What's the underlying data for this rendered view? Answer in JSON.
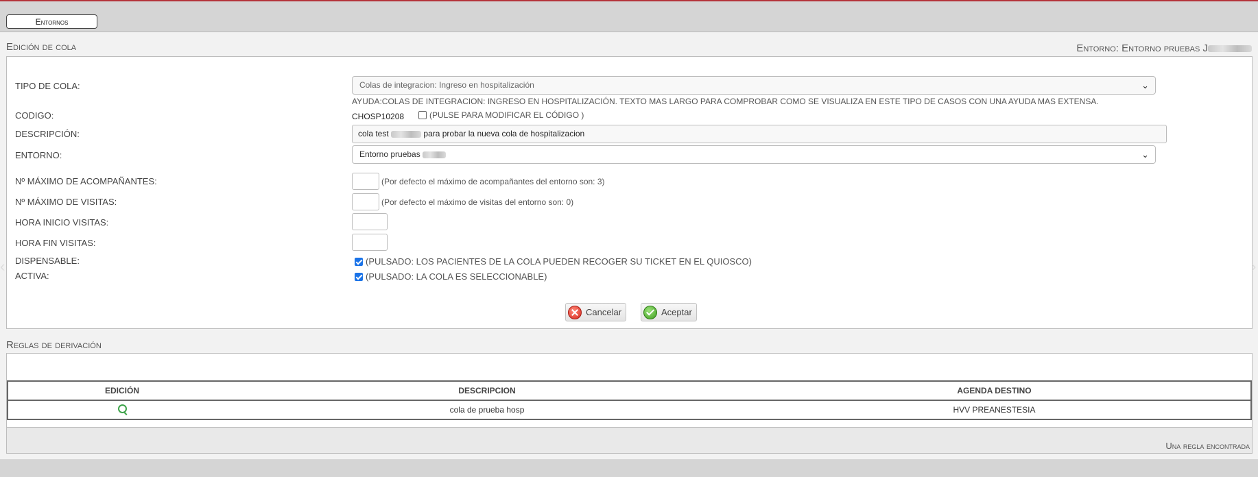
{
  "nav": {
    "entornos_label": "Entornos"
  },
  "edit_section": {
    "title": "Edición de cola",
    "environment_label": "Entorno: Entorno pruebas J"
  },
  "form": {
    "tipo_label": "TIPO DE COLA:",
    "tipo_value": "Colas de integracion: Ingreso en hospitalización",
    "tipo_help": "AYUDA:COLAS DE INTEGRACION: INGRESO EN HOSPITALIZACIÓN. TEXTO MAS LARGO PARA COMPROBAR COMO SE VISUALIZA EN ESTE TIPO DE CASOS CON UNA AYUDA MAS EXTENSA.",
    "codigo_label": "CODIGO:",
    "codigo_value": "CHOSP10208",
    "codigo_note": "(PULSE PARA MODIFICAR EL CÓDIGO )",
    "descripcion_label": "DESCRIPCIÓN:",
    "descripcion_prefix": "cola test",
    "descripcion_suffix": "para probar la nueva cola de hospitalizacion",
    "entorno_label": "ENTORNO:",
    "entorno_value": "Entorno pruebas",
    "max_acomp_label": "Nº MÁXIMO DE ACOMPAÑANTES:",
    "max_acomp_value": "",
    "max_acomp_hint": "(Por defecto el máximo de acompañantes del entorno son: 3)",
    "max_visitas_label": "Nº MÁXIMO DE VISITAS:",
    "max_visitas_value": "",
    "max_visitas_hint": "(Por defecto el máximo de visitas del entorno son: 0)",
    "hora_inicio_label": "HORA INICIO VISITAS:",
    "hora_inicio_value": "",
    "hora_fin_label": "HORA FIN VISITAS:",
    "hora_fin_value": "",
    "dispensable_label": "DISPENSABLE:",
    "dispensable_checked": true,
    "dispensable_note": "(PULSADO: LOS PACIENTES DE LA COLA PUEDEN RECOGER SU TICKET EN EL QUIOSCO)",
    "activa_label": "ACTIVA:",
    "activa_checked": true,
    "activa_note": "(PULSADO: LA COLA ES SELECCIONABLE)",
    "cancel_label": "Cancelar",
    "accept_label": "Aceptar"
  },
  "rules_section": {
    "title": "Reglas de derivación",
    "columns": [
      "EDICIÓN",
      "DESCRIPCION",
      "AGENDA DESTINO"
    ],
    "rows": [
      {
        "edit_icon": "magnifier-icon",
        "descripcion": "cola de prueba hosp",
        "agenda": "HVV PREANESTESIA"
      }
    ],
    "footer": "Una regla encontrada"
  },
  "colors": {
    "accent_top": "#b5333a",
    "checkbox": "#1a73e8",
    "edit_icon": "#3ea34a"
  }
}
